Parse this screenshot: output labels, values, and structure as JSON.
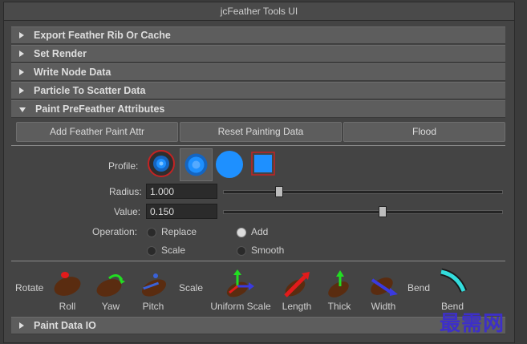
{
  "window": {
    "title": "jcFeather Tools UI"
  },
  "sections": [
    {
      "label": "Export Feather Rib Or Cache",
      "expanded": false
    },
    {
      "label": "Set Render",
      "expanded": false
    },
    {
      "label": "Write Node Data",
      "expanded": false
    },
    {
      "label": "Particle To Scatter Data",
      "expanded": false
    },
    {
      "label": "Paint PreFeather Attributes",
      "expanded": true
    }
  ],
  "paint": {
    "buttons": {
      "add": "Add Feather Paint Attr",
      "reset": "Reset Painting Data",
      "flood": "Flood"
    },
    "profile_label": "Profile:",
    "profile_icons": [
      "soft-circle-brush-icon",
      "gaussian-brush-icon",
      "solid-circle-brush-icon",
      "square-brush-icon"
    ],
    "radius": {
      "label": "Radius:",
      "value": "1.000",
      "slider_fraction": 0.2
    },
    "value": {
      "label": "Value:",
      "value": "0.150",
      "slider_fraction": 0.57
    },
    "operation": {
      "label": "Operation:",
      "options": [
        "Replace",
        "Add",
        "Scale",
        "Smooth"
      ],
      "selected": "Add"
    },
    "tools": {
      "rotate_label": "Rotate",
      "scale_label": "Scale",
      "bend_label": "Bend",
      "rotate": [
        "Roll",
        "Yaw",
        "Pitch"
      ],
      "scale": [
        "Uniform Scale",
        "Length",
        "Thick",
        "Width"
      ],
      "bend": [
        "Bend"
      ]
    }
  },
  "footer_section": {
    "label": "Paint Data IO",
    "expanded": false
  },
  "watermark": "最需网",
  "colors": {
    "accent_blue": "#1e90ff",
    "selection_red": "#c42323",
    "green_arrow": "#22dd22",
    "teal": "#33dddd"
  }
}
